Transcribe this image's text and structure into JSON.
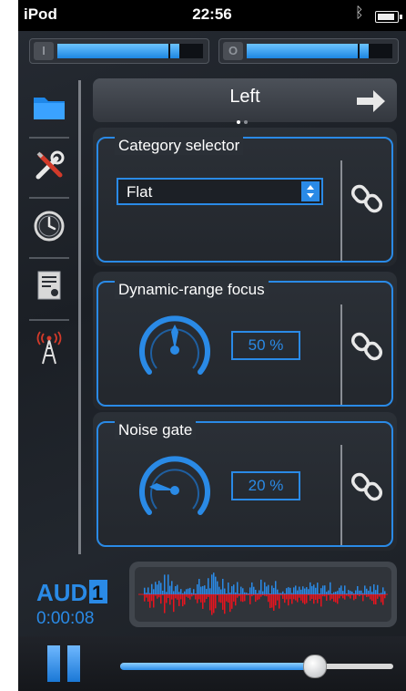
{
  "status_bar": {
    "carrier": "iPod",
    "time": "22:56",
    "bluetooth_icon": "bluetooth-icon",
    "battery_icon": "battery-icon"
  },
  "meters": {
    "input": {
      "label": "I",
      "level": 0.84
    },
    "output": {
      "label": "O",
      "level": 0.84
    }
  },
  "sidebar": {
    "items": [
      {
        "name": "folder",
        "icon": "folder-icon",
        "selected": true
      },
      {
        "name": "tools",
        "icon": "tools-icon",
        "selected": false
      },
      {
        "name": "clock",
        "icon": "clock-icon",
        "selected": false
      },
      {
        "name": "certificate",
        "icon": "certificate-icon",
        "selected": false
      },
      {
        "name": "antenna",
        "icon": "antenna-icon",
        "selected": false
      }
    ]
  },
  "header": {
    "title": "Left",
    "page_count": 2,
    "current_page": 1,
    "next_icon": "arrow-right-icon"
  },
  "panels": {
    "category": {
      "label": "Category selector",
      "selected_value": "Flat",
      "link_icon": "link-icon"
    },
    "dynamic_range": {
      "label": "Dynamic-range focus",
      "value_text": "50 %",
      "value": 0.5,
      "link_icon": "link-icon"
    },
    "noise_gate": {
      "label": "Noise gate",
      "value_text": "20 %",
      "value": 0.2,
      "link_icon": "link-icon"
    }
  },
  "info": {
    "logo": "AUD1",
    "timecode": "0:00:08"
  },
  "waveform": {
    "positive_color": "#2a8ae6",
    "negative_color": "#e8141e"
  },
  "controls": {
    "pause_icon": "pause-icon",
    "progress": 0.71
  },
  "colors": {
    "accent": "#2a8ae6",
    "background": "#1f2329"
  }
}
